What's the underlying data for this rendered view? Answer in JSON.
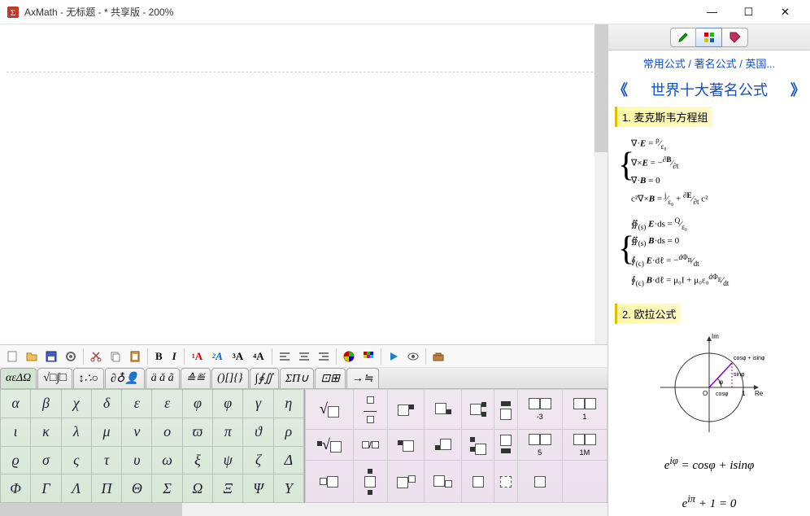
{
  "window": {
    "title": "AxMath - 无标题 - * 共享版 - 200%",
    "minimize": "—",
    "maximize": "☐",
    "close": "✕"
  },
  "toolbar1": {
    "new": "📄",
    "open": "📂",
    "save": "💾",
    "settings": "⚙",
    "cut": "✂",
    "copy": "📋",
    "paste": "📋",
    "bold": "B",
    "italic": "I",
    "fmt1": "A",
    "fmt2": "A",
    "fmt3": "A",
    "fmt4": "A",
    "align_l": "≡",
    "align_c": "≡",
    "align_r": "≡",
    "color": "●",
    "grid": "▦",
    "play": "▶",
    "eye": "👁",
    "toolbox": "🧰"
  },
  "tabs": [
    "αεΔΩ",
    "√□∫□",
    "↕∴○",
    "∂♁👤",
    "ä ǎ ã",
    "≙≝",
    "()[]{}",
    "∫∮∬",
    "ΣΠ∪",
    "⊡⊞",
    "→≒"
  ],
  "greek": [
    [
      "α",
      "β",
      "χ",
      "δ",
      "ε",
      "ε",
      "φ",
      "φ",
      "γ",
      "η"
    ],
    [
      "ι",
      "κ",
      "λ",
      "μ",
      "ν",
      "ο",
      "ϖ",
      "π",
      "ϑ",
      "ρ"
    ],
    [
      "ϱ",
      "σ",
      "ς",
      "τ",
      "υ",
      "ω",
      "ξ",
      "ψ",
      "ζ",
      "Δ"
    ],
    [
      "Φ",
      "Γ",
      "Λ",
      "Π",
      "Θ",
      "Σ",
      "Ω",
      "Ξ",
      "Ψ",
      "Υ"
    ]
  ],
  "templates": {
    "r1c1": "√□",
    "r1c7_sub": "-3",
    "r1c8_sub": "1",
    "r2c1": "ⁿ√□",
    "r2c7_sub": "5",
    "r2c8_sub": "1M"
  },
  "sidebar": {
    "breadcrumb": [
      "常用公式",
      "著名公式",
      "英国..."
    ],
    "sep": " / ",
    "title": "世界十大著名公式",
    "prev": "《",
    "next": "》",
    "sections": [
      {
        "title": "1. 麦克斯韦方程组"
      },
      {
        "title": "2. 欧拉公式"
      }
    ],
    "euler1": "e^{iφ} = cosφ + isinφ",
    "euler2": "e^{iπ} + 1 = 0",
    "circle_labels": {
      "im": "Im",
      "re": "Re",
      "one": "1",
      "o": "O",
      "top": "cosφ + isinφ",
      "side": "sinφ",
      "bottom": "cosφ"
    }
  }
}
